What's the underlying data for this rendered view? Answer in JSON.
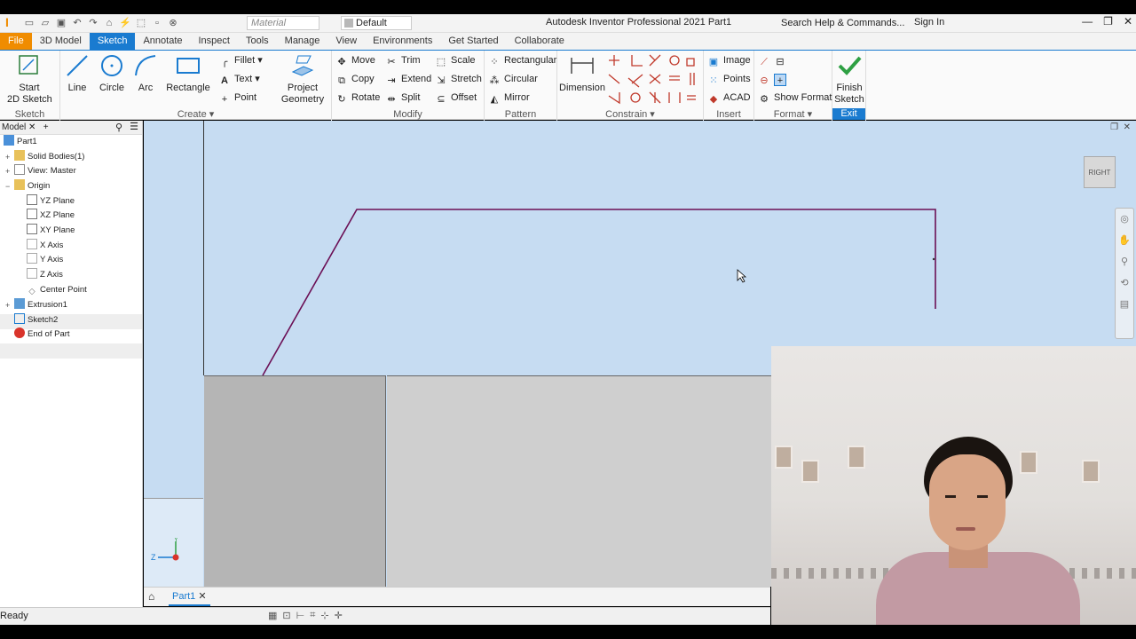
{
  "titlebar": {
    "app_letter": "I",
    "material_value": "Material",
    "appearance_value": "Default",
    "title": "Autodesk Inventor Professional 2021   Part1",
    "search_placeholder": "Search Help & Commands...",
    "signin_label": "Sign In"
  },
  "tabs": [
    "File",
    "3D Model",
    "Sketch",
    "Annotate",
    "Inspect",
    "Tools",
    "Manage",
    "View",
    "Environments",
    "Get Started",
    "Collaborate"
  ],
  "active_tab": "Sketch",
  "ribbon": {
    "sketch": {
      "start_label": "Start\n2D Sketch",
      "title": "Sketch"
    },
    "create": {
      "line": "Line",
      "circle": "Circle",
      "arc": "Arc",
      "rectangle": "Rectangle",
      "fillet": "Fillet",
      "text": "Text",
      "point": "Point",
      "project": "Project\nGeometry",
      "title": "Create"
    },
    "modify": {
      "move": "Move",
      "copy": "Copy",
      "rotate": "Rotate",
      "trim": "Trim",
      "extend": "Extend",
      "split": "Split",
      "scale": "Scale",
      "stretch": "Stretch",
      "offset": "Offset",
      "title": "Modify"
    },
    "pattern": {
      "rectangular": "Rectangular",
      "circular": "Circular",
      "mirror": "Mirror",
      "title": "Pattern"
    },
    "constrain": {
      "dimension": "Dimension",
      "title": "Constrain"
    },
    "insert": {
      "image": "Image",
      "points": "Points",
      "acad": "ACAD",
      "title": "Insert"
    },
    "format": {
      "show_format": "Show Format",
      "title": "Format"
    },
    "exit": {
      "finish": "Finish\nSketch",
      "title": "Exit"
    }
  },
  "browser": {
    "tab_label": "Model",
    "nodes": [
      {
        "label": "Part1"
      },
      {
        "label": "Solid Bodies(1)"
      },
      {
        "label": "View: Master"
      },
      {
        "label": "Origin"
      },
      {
        "label": "YZ Plane"
      },
      {
        "label": "XZ Plane"
      },
      {
        "label": "XY Plane"
      },
      {
        "label": "X Axis"
      },
      {
        "label": "Y Axis"
      },
      {
        "label": "Z Axis"
      },
      {
        "label": "Center Point"
      },
      {
        "label": "Extrusion1"
      },
      {
        "label": "Sketch2"
      },
      {
        "label": "End of Part"
      }
    ]
  },
  "viewcube_label": "RIGHT",
  "doc_tab": "Part1",
  "status_text": "Ready",
  "colors": {
    "accent": "#1a7bd0",
    "file_tab": "#f08c00",
    "sketch_line": "#6b0f55"
  }
}
